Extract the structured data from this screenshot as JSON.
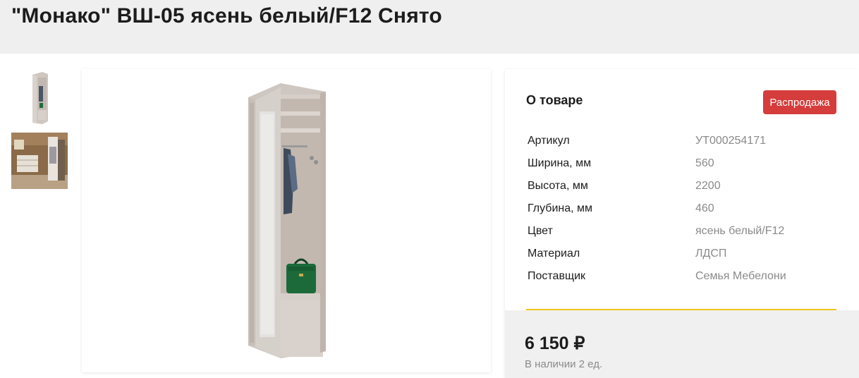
{
  "header": {
    "title": "\"Монако\" ВШ-05 ясень белый/F12 Снято"
  },
  "gallery": {
    "thumbnails": [
      {
        "icon": "wardrobe-thumbnail-image"
      },
      {
        "icon": "interior-thumbnail-image"
      }
    ],
    "main_image_icon": "wardrobe-product-image"
  },
  "info": {
    "heading": "О товаре",
    "badge": "Распродажа",
    "specs": [
      {
        "name": "Артикул",
        "value": "УТ000254171"
      },
      {
        "name": "Ширина, мм",
        "value": "560"
      },
      {
        "name": "Высота, мм",
        "value": "2200"
      },
      {
        "name": "Глубина, мм",
        "value": "460"
      },
      {
        "name": "Цвет",
        "value": "ясень белый/F12"
      },
      {
        "name": "Материал",
        "value": "ЛДСП"
      },
      {
        "name": "Поставщик",
        "value": "Семья Мебелони"
      }
    ]
  },
  "price": {
    "amount": "6 150 ₽",
    "stock": "В наличии 2 ед."
  },
  "colors": {
    "badge": "#d53c3c",
    "divider": "#f0c419",
    "spec_value": "#8a8a8a"
  }
}
